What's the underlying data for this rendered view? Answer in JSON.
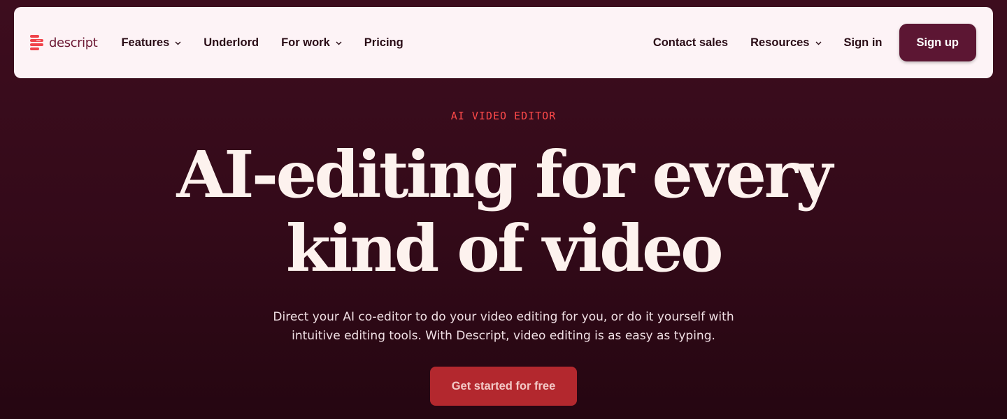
{
  "brand": {
    "name": "descript",
    "color": "#6e1b36",
    "logo_stripe_color": "#f0434b"
  },
  "nav": {
    "left": [
      {
        "label": "Features",
        "dropdown": true
      },
      {
        "label": "Underlord",
        "dropdown": false
      },
      {
        "label": "For work",
        "dropdown": true
      },
      {
        "label": "Pricing",
        "dropdown": false
      }
    ],
    "right": [
      {
        "label": "Contact sales",
        "dropdown": false
      },
      {
        "label": "Resources",
        "dropdown": true
      },
      {
        "label": "Sign in",
        "dropdown": false
      }
    ],
    "signup_label": "Sign up"
  },
  "hero": {
    "eyebrow": "AI VIDEO EDITOR",
    "headline_line1": "AI-editing for every",
    "headline_line2": "kind of video",
    "subhead_line1": "Direct your AI co-editor to do your video editing for you, or do it yourself with",
    "subhead_line2": "intuitive editing tools. With Descript, video editing is as easy as typing.",
    "cta_label": "Get started for free"
  },
  "colors": {
    "background": "#3d0d1e",
    "nav_background": "#fdf3f6",
    "signup_button": "#5c1633",
    "cta_button": "#b3282e",
    "eyebrow": "#ff4a4a",
    "headline": "#fdf2ee"
  },
  "icons": {
    "chevron": "chevron-down-icon",
    "logo": "descript-logo-icon"
  }
}
